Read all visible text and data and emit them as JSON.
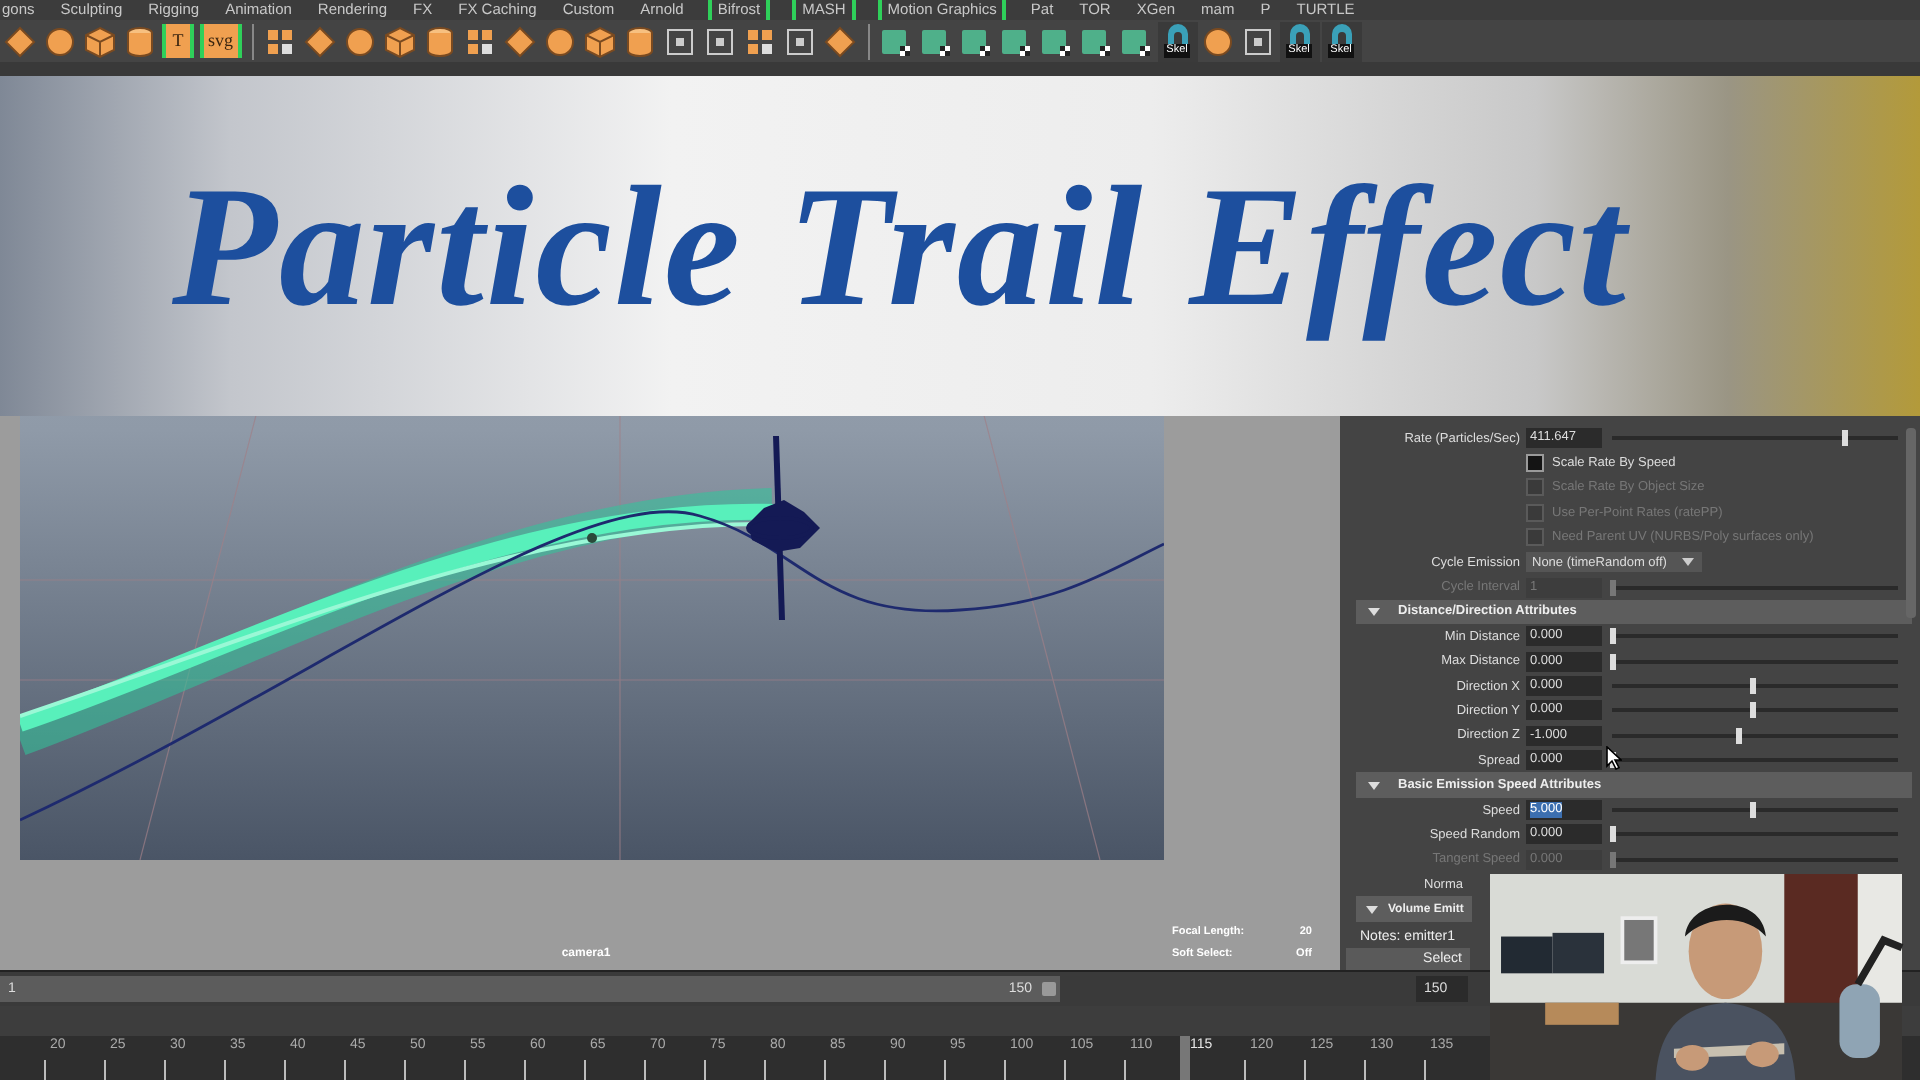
{
  "shelf_tabs": [
    {
      "label": "gons",
      "bracketed": false
    },
    {
      "label": "Sculpting",
      "bracketed": false
    },
    {
      "label": "Rigging",
      "bracketed": false
    },
    {
      "label": "Animation",
      "bracketed": false
    },
    {
      "label": "Rendering",
      "bracketed": false
    },
    {
      "label": "FX",
      "bracketed": false
    },
    {
      "label": "FX Caching",
      "bracketed": false
    },
    {
      "label": "Custom",
      "bracketed": false
    },
    {
      "label": "Arnold",
      "bracketed": false
    },
    {
      "label": "Bifrost",
      "bracketed": true
    },
    {
      "label": "MASH",
      "bracketed": true
    },
    {
      "label": "Motion Graphics",
      "bracketed": true
    },
    {
      "label": "Pat",
      "bracketed": false
    },
    {
      "label": "TOR",
      "bracketed": false
    },
    {
      "label": "XGen",
      "bracketed": false
    },
    {
      "label": "mam",
      "bracketed": false
    },
    {
      "label": "P",
      "bracketed": false
    },
    {
      "label": "TURTLE",
      "bracketed": false
    }
  ],
  "shelf": [
    {
      "kind": "orange"
    },
    {
      "kind": "orange"
    },
    {
      "kind": "orange"
    },
    {
      "kind": "orange"
    },
    {
      "kind": "text",
      "label": "T"
    },
    {
      "kind": "text",
      "label": "svg"
    },
    {
      "kind": "divider"
    },
    {
      "kind": "orange"
    },
    {
      "kind": "orange"
    },
    {
      "kind": "orange"
    },
    {
      "kind": "orange"
    },
    {
      "kind": "orange"
    },
    {
      "kind": "orange"
    },
    {
      "kind": "orange"
    },
    {
      "kind": "orange"
    },
    {
      "kind": "orange"
    },
    {
      "kind": "orange"
    },
    {
      "kind": "outline"
    },
    {
      "kind": "outline"
    },
    {
      "kind": "orange"
    },
    {
      "kind": "outline"
    },
    {
      "kind": "orange"
    },
    {
      "kind": "divider"
    },
    {
      "kind": "green"
    },
    {
      "kind": "green"
    },
    {
      "kind": "green"
    },
    {
      "kind": "green"
    },
    {
      "kind": "green"
    },
    {
      "kind": "green"
    },
    {
      "kind": "green"
    },
    {
      "kind": "skel",
      "label": "Skel"
    },
    {
      "kind": "orange"
    },
    {
      "kind": "outline"
    },
    {
      "kind": "skel",
      "label": "Skel"
    },
    {
      "kind": "skel",
      "label": "Skel"
    }
  ],
  "banner": {
    "title": "Particle Trail Effect"
  },
  "viewport": {
    "camera": "camera1",
    "hud": [
      {
        "label": "Focal Length:",
        "value": "20"
      },
      {
        "label": "Soft Select:",
        "value": "Off"
      }
    ]
  },
  "attributes": [
    {
      "kind": "field",
      "label": "Rate (Particles/Sec)",
      "value": "411.647",
      "level": 0.81,
      "disabled": false,
      "text_selected": false
    },
    {
      "kind": "check",
      "label": "Scale Rate By Speed",
      "checked": false,
      "disabled": false
    },
    {
      "kind": "check",
      "label": "Scale Rate By Object Size",
      "checked": false,
      "disabled": true
    },
    {
      "kind": "check",
      "label": "Use Per-Point Rates (ratePP)",
      "checked": false,
      "disabled": true
    },
    {
      "kind": "check",
      "label": "Need Parent UV (NURBS/Poly surfaces only)",
      "checked": false,
      "disabled": true
    },
    {
      "kind": "dropdown",
      "label": "Cycle Emission",
      "value": "None (timeRandom off)"
    },
    {
      "kind": "field",
      "label": "Cycle Interval",
      "value": "1",
      "level": 0.0,
      "disabled": true,
      "text_selected": false
    },
    {
      "kind": "header",
      "label": "Distance/Direction Attributes",
      "expanded": true
    },
    {
      "kind": "field",
      "label": "Min Distance",
      "value": "0.000",
      "level": 0.0,
      "disabled": false,
      "text_selected": false
    },
    {
      "kind": "field",
      "label": "Max Distance",
      "value": "0.000",
      "level": 0.0,
      "disabled": false,
      "text_selected": false
    },
    {
      "kind": "field",
      "label": "Direction X",
      "value": "0.000",
      "level": 0.49,
      "disabled": false,
      "text_selected": false
    },
    {
      "kind": "field",
      "label": "Direction Y",
      "value": "0.000",
      "level": 0.49,
      "disabled": false,
      "text_selected": false
    },
    {
      "kind": "field",
      "label": "Direction Z",
      "value": "-1.000",
      "level": 0.44,
      "disabled": false,
      "text_selected": false
    },
    {
      "kind": "field",
      "label": "Spread",
      "value": "0.000",
      "level": 0.0,
      "disabled": false,
      "text_selected": false
    },
    {
      "kind": "header",
      "label": "Basic Emission Speed Attributes",
      "expanded": true
    },
    {
      "kind": "field",
      "label": "Speed",
      "value": "5.000",
      "level": 0.49,
      "disabled": false,
      "text_selected": true
    },
    {
      "kind": "field",
      "label": "Speed Random",
      "value": "0.000",
      "level": 0.0,
      "disabled": false,
      "text_selected": false
    },
    {
      "kind": "field",
      "label": "Tangent Speed",
      "value": "0.000",
      "level": 0.0,
      "disabled": true,
      "text_selected": false
    },
    {
      "kind": "cut",
      "label": "Norma"
    },
    {
      "kind": "cut_header",
      "label": "Volume Emitt",
      "expanded": true
    }
  ],
  "notes": "Notes:  emitter1",
  "select_button": "Select",
  "range": {
    "start": "1",
    "end": "150",
    "end_field": "150",
    "level": 1.0
  },
  "ticks": [
    {
      "label": "20",
      "selected": false
    },
    {
      "label": "25",
      "selected": false
    },
    {
      "label": "30",
      "selected": false
    },
    {
      "label": "35",
      "selected": false
    },
    {
      "label": "40",
      "selected": false
    },
    {
      "label": "45",
      "selected": false
    },
    {
      "label": "50",
      "selected": false
    },
    {
      "label": "55",
      "selected": false
    },
    {
      "label": "60",
      "selected": false
    },
    {
      "label": "65",
      "selected": false
    },
    {
      "label": "70",
      "selected": false
    },
    {
      "label": "75",
      "selected": false
    },
    {
      "label": "80",
      "selected": false
    },
    {
      "label": "85",
      "selected": false
    },
    {
      "label": "90",
      "selected": false
    },
    {
      "label": "95",
      "selected": false
    },
    {
      "label": "100",
      "selected": false
    },
    {
      "label": "105",
      "selected": false
    },
    {
      "label": "110",
      "selected": false
    },
    {
      "label": "115",
      "selected": true
    },
    {
      "label": "120",
      "selected": false
    },
    {
      "label": "125",
      "selected": false
    },
    {
      "label": "130",
      "selected": false
    },
    {
      "label": "135",
      "selected": false
    }
  ]
}
